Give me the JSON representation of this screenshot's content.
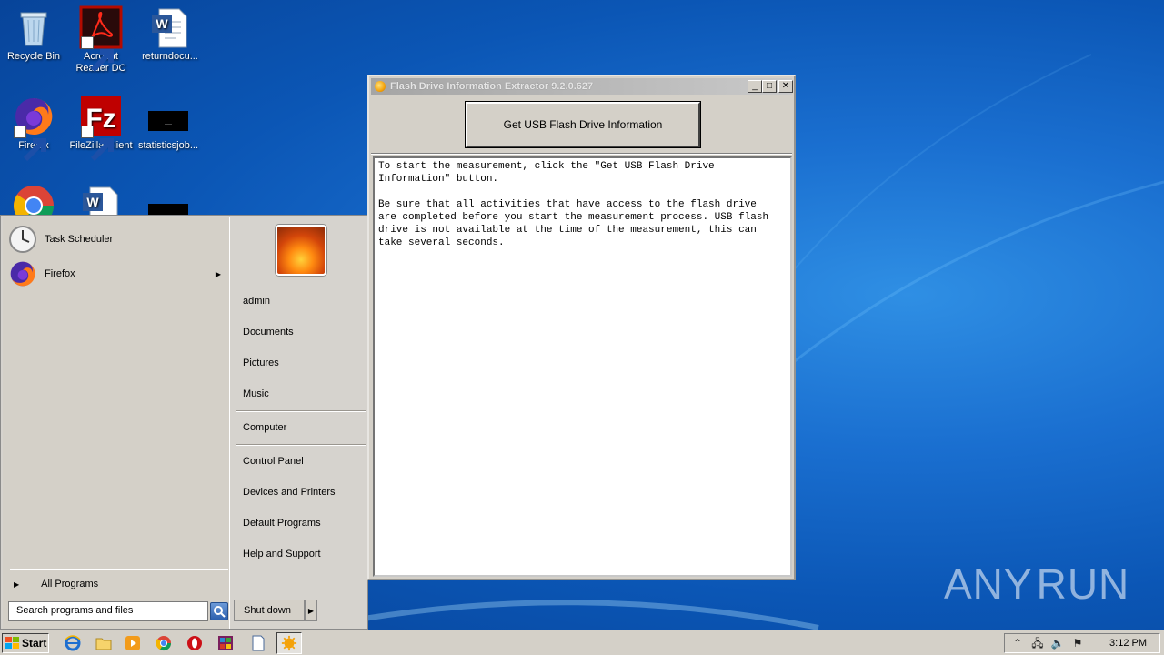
{
  "desktop": {
    "icons": [
      {
        "label": "Recycle Bin"
      },
      {
        "label": "Acrobat\nReader DC"
      },
      {
        "label": "returndocu..."
      },
      {
        "label": "Firefox"
      },
      {
        "label": "FileZilla Client"
      },
      {
        "label": "statisticsjob..."
      },
      {
        "label": "Chrome"
      },
      {
        "label": "Word doc"
      },
      {
        "label": "black file"
      }
    ]
  },
  "start_menu": {
    "programs": [
      {
        "label": "Task Scheduler"
      },
      {
        "label": "Firefox"
      }
    ],
    "all_programs": "All Programs",
    "search_placeholder": "Search programs and files",
    "right_items": [
      "admin",
      "Documents",
      "Pictures",
      "Music",
      "Computer",
      "Control Panel",
      "Devices and Printers",
      "Default Programs",
      "Help and Support"
    ],
    "shutdown": "Shut down"
  },
  "app_window": {
    "title": "Flash Drive Information Extractor 9.2.0.627",
    "button_label": "Get USB Flash Drive Information",
    "info_text": "To start the measurement, click the \"Get USB Flash Drive\nInformation\" button.\n\nBe sure that all activities that have access to the flash drive\nare completed before you start the measurement process. USB flash\ndrive is not available at the time of the measurement, this can\ntake several seconds."
  },
  "watermark": {
    "left": "ANY",
    "right": "RUN"
  },
  "taskbar": {
    "start_label": "Start",
    "clock": "3:12 PM"
  },
  "colors": {
    "desktop_blue": "#0b56b5",
    "window_gray": "#d4d0c8",
    "titlebar_text": "#e6e6e6"
  }
}
